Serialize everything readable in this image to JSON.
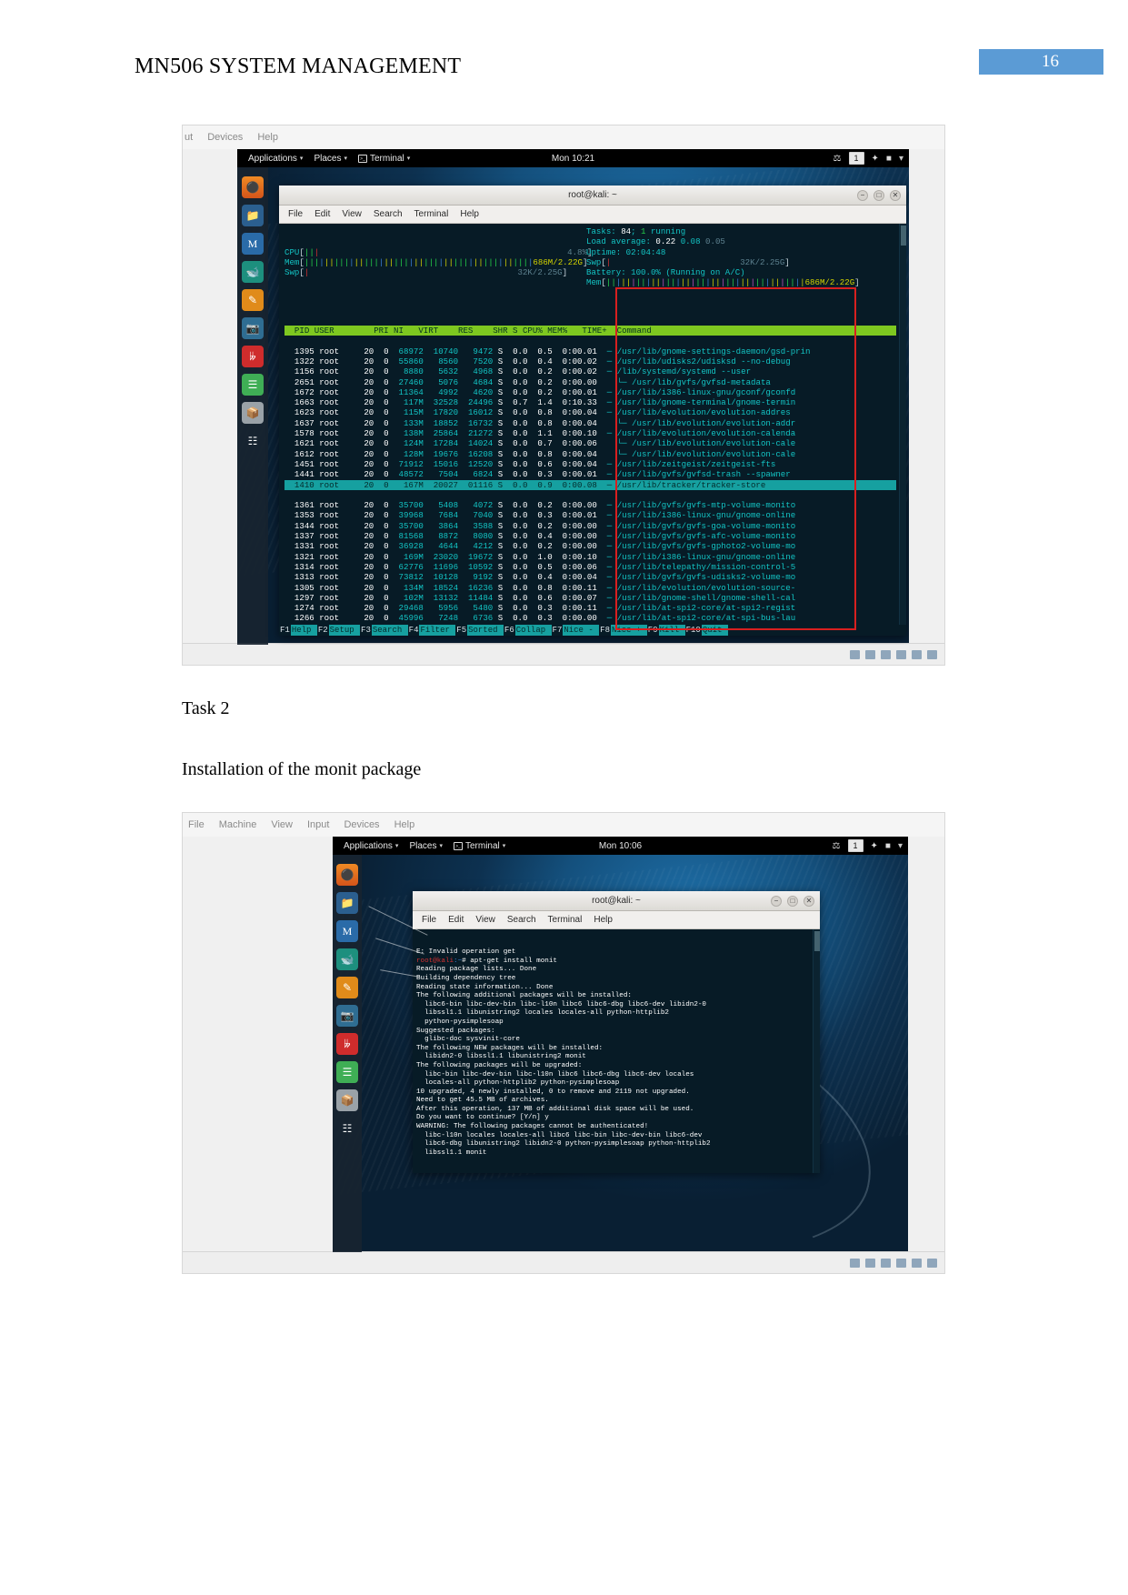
{
  "document": {
    "header_title": "MN506 SYSTEM MANAGEMENT",
    "page_number": "16",
    "accent_color": "#5b9bd5"
  },
  "body": {
    "task_heading": "Task 2",
    "section_text": "Installation of the monit package"
  },
  "figure1": {
    "vbox_menu": [
      "ut",
      "Devices",
      "Help"
    ],
    "panel": {
      "applications": "Applications",
      "places": "Places",
      "terminal": "Terminal",
      "clock": "Mon 10:21",
      "workspace": "1",
      "caret": "▾"
    },
    "window": {
      "title": "root@kali: ~",
      "menu": [
        "File",
        "Edit",
        "View",
        "Search",
        "Terminal",
        "Help"
      ],
      "minimize": "−",
      "maximize": "□",
      "close": "✕"
    },
    "htop": {
      "cpu_label": "CPU",
      "cpu_value": "4.8%",
      "mem_label": "Mem",
      "mem_value": "686M/2.22G",
      "swp_label": "Swp",
      "swp_value": "32K/2.25G",
      "tasks": "Tasks: 84; 1 running",
      "tasks_count": "84",
      "tasks_running": "1",
      "load_label": "Load average:",
      "load_1": "0.22",
      "load_5": "0.08",
      "load_15": "0.05",
      "uptime_label": "Uptime:",
      "uptime_value": "02:04:48",
      "swp2_label": "Swp",
      "swp2_value": "32K/2.25G",
      "battery": "Battery: 100.0% (Running on A/C)",
      "mem2_value": "686M/2.22G",
      "columns": [
        "PID",
        "USER",
        "PRI",
        "NI",
        "VIRT",
        "RES",
        "SHR",
        "S",
        "CPU%",
        "MEM%",
        "TIME+",
        "Command"
      ],
      "rows": [
        {
          "pid": "1395",
          "user": "root",
          "pri": "20",
          "ni": "0",
          "virt": "68972",
          "res": "10740",
          "shr": "9472",
          "s": "S",
          "cpu": "0.0",
          "mem": "0.5",
          "time": "0:00.01",
          "cmd": "─ /usr/lib/gnome-settings-daemon/gsd-prin",
          "sel": false
        },
        {
          "pid": "1322",
          "user": "root",
          "pri": "20",
          "ni": "0",
          "virt": "55860",
          "res": "8560",
          "shr": "7520",
          "s": "S",
          "cpu": "0.0",
          "mem": "0.4",
          "time": "0:00.02",
          "cmd": "─ /usr/lib/udisks2/udisksd --no-debug",
          "sel": false
        },
        {
          "pid": "1156",
          "user": "root",
          "pri": "20",
          "ni": "0",
          "virt": "8880",
          "res": "5632",
          "shr": "4968",
          "s": "S",
          "cpu": "0.0",
          "mem": "0.2",
          "time": "0:00.02",
          "cmd": "─ /lib/systemd/systemd --user",
          "sel": false
        },
        {
          "pid": "2651",
          "user": "root",
          "pri": "20",
          "ni": "0",
          "virt": "27460",
          "res": "5076",
          "shr": "4684",
          "s": "S",
          "cpu": "0.0",
          "mem": "0.2",
          "time": "0:00.00",
          "cmd": "  └─ /usr/lib/gvfs/gvfsd-metadata",
          "sel": false
        },
        {
          "pid": "1672",
          "user": "root",
          "pri": "20",
          "ni": "0",
          "virt": "11364",
          "res": "4992",
          "shr": "4620",
          "s": "S",
          "cpu": "0.0",
          "mem": "0.2",
          "time": "0:00.01",
          "cmd": "─ /usr/lib/i386-linux-gnu/gconf/gconfd",
          "sel": false
        },
        {
          "pid": "1663",
          "user": "root",
          "pri": "20",
          "ni": "0",
          "virt": "117M",
          "res": "32528",
          "shr": "24496",
          "s": "S",
          "cpu": "0.7",
          "mem": "1.4",
          "time": "0:10.33",
          "cmd": "─ /usr/lib/gnome-terminal/gnome-termin",
          "sel": false
        },
        {
          "pid": "1623",
          "user": "root",
          "pri": "20",
          "ni": "0",
          "virt": "115M",
          "res": "17820",
          "shr": "16012",
          "s": "S",
          "cpu": "0.0",
          "mem": "0.8",
          "time": "0:00.04",
          "cmd": "─ /usr/lib/evolution/evolution-addres",
          "sel": false
        },
        {
          "pid": "1637",
          "user": "root",
          "pri": "20",
          "ni": "0",
          "virt": "133M",
          "res": "18852",
          "shr": "16732",
          "s": "S",
          "cpu": "0.0",
          "mem": "0.8",
          "time": "0:00.04",
          "cmd": "  └─ /usr/lib/evolution/evolution-addr",
          "sel": false
        },
        {
          "pid": "1578",
          "user": "root",
          "pri": "20",
          "ni": "0",
          "virt": "138M",
          "res": "25864",
          "shr": "21272",
          "s": "S",
          "cpu": "0.0",
          "mem": "1.1",
          "time": "0:00.10",
          "cmd": "─ /usr/lib/evolution/evolution-calenda",
          "sel": false
        },
        {
          "pid": "1621",
          "user": "root",
          "pri": "20",
          "ni": "0",
          "virt": "124M",
          "res": "17284",
          "shr": "14024",
          "s": "S",
          "cpu": "0.0",
          "mem": "0.7",
          "time": "0:00.06",
          "cmd": "  └─ /usr/lib/evolution/evolution-cale",
          "sel": false
        },
        {
          "pid": "1612",
          "user": "root",
          "pri": "20",
          "ni": "0",
          "virt": "128M",
          "res": "19676",
          "shr": "16208",
          "s": "S",
          "cpu": "0.0",
          "mem": "0.8",
          "time": "0:00.04",
          "cmd": "  └─ /usr/lib/evolution/evolution-cale",
          "sel": false
        },
        {
          "pid": "1451",
          "user": "root",
          "pri": "20",
          "ni": "0",
          "virt": "71912",
          "res": "15016",
          "shr": "12520",
          "s": "S",
          "cpu": "0.0",
          "mem": "0.6",
          "time": "0:00.04",
          "cmd": "─ /usr/lib/zeitgeist/zeitgeist-fts",
          "sel": false
        },
        {
          "pid": "1441",
          "user": "root",
          "pri": "20",
          "ni": "0",
          "virt": "48572",
          "res": "7504",
          "shr": "6824",
          "s": "S",
          "cpu": "0.0",
          "mem": "0.3",
          "time": "0:00.01",
          "cmd": "─ /usr/lib/gvfs/gvfsd-trash --spawner",
          "sel": false
        },
        {
          "pid": "1410",
          "user": "root",
          "pri": "20",
          "ni": "0",
          "virt": "167M",
          "res": "20027",
          "shr": "01116",
          "s": "S",
          "cpu": "0.0",
          "mem": "0.9",
          "time": "0:00.08",
          "cmd": "─ /usr/lib/tracker/tracker-store",
          "sel": true
        },
        {
          "pid": "1361",
          "user": "root",
          "pri": "20",
          "ni": "0",
          "virt": "35700",
          "res": "5408",
          "shr": "4072",
          "s": "S",
          "cpu": "0.0",
          "mem": "0.2",
          "time": "0:00.00",
          "cmd": "─ /usr/lib/gvfs/gvfs-mtp-volume-monito",
          "sel": false
        },
        {
          "pid": "1353",
          "user": "root",
          "pri": "20",
          "ni": "0",
          "virt": "39968",
          "res": "7684",
          "shr": "7040",
          "s": "S",
          "cpu": "0.0",
          "mem": "0.3",
          "time": "0:00.01",
          "cmd": "─ /usr/lib/i386-linux-gnu/gnome-online",
          "sel": false
        },
        {
          "pid": "1344",
          "user": "root",
          "pri": "20",
          "ni": "0",
          "virt": "35700",
          "res": "3864",
          "shr": "3588",
          "s": "S",
          "cpu": "0.0",
          "mem": "0.2",
          "time": "0:00.00",
          "cmd": "─ /usr/lib/gvfs/gvfs-goa-volume-monito",
          "sel": false
        },
        {
          "pid": "1337",
          "user": "root",
          "pri": "20",
          "ni": "0",
          "virt": "81568",
          "res": "8872",
          "shr": "8080",
          "s": "S",
          "cpu": "0.0",
          "mem": "0.4",
          "time": "0:00.00",
          "cmd": "─ /usr/lib/gvfs/gvfs-afc-volume-monito",
          "sel": false
        },
        {
          "pid": "1331",
          "user": "root",
          "pri": "20",
          "ni": "0",
          "virt": "36928",
          "res": "4644",
          "shr": "4212",
          "s": "S",
          "cpu": "0.0",
          "mem": "0.2",
          "time": "0:00.00",
          "cmd": "─ /usr/lib/gvfs/gvfs-gphoto2-volume-mo",
          "sel": false
        },
        {
          "pid": "1321",
          "user": "root",
          "pri": "20",
          "ni": "0",
          "virt": "169M",
          "res": "23020",
          "shr": "19672",
          "s": "S",
          "cpu": "0.0",
          "mem": "1.0",
          "time": "0:00.10",
          "cmd": "─ /usr/lib/i386-linux-gnu/gnome-online",
          "sel": false
        },
        {
          "pid": "1314",
          "user": "root",
          "pri": "20",
          "ni": "0",
          "virt": "62776",
          "res": "11696",
          "shr": "10592",
          "s": "S",
          "cpu": "0.0",
          "mem": "0.5",
          "time": "0:00.06",
          "cmd": "─ /usr/lib/telepathy/mission-control-5",
          "sel": false
        },
        {
          "pid": "1313",
          "user": "root",
          "pri": "20",
          "ni": "0",
          "virt": "73812",
          "res": "10128",
          "shr": "9192",
          "s": "S",
          "cpu": "0.0",
          "mem": "0.4",
          "time": "0:00.04",
          "cmd": "─ /usr/lib/gvfs/gvfs-udisks2-volume-mo",
          "sel": false
        },
        {
          "pid": "1305",
          "user": "root",
          "pri": "20",
          "ni": "0",
          "virt": "134M",
          "res": "18524",
          "shr": "16236",
          "s": "S",
          "cpu": "0.0",
          "mem": "0.8",
          "time": "0:00.11",
          "cmd": "─ /usr/lib/evolution/evolution-source-",
          "sel": false
        },
        {
          "pid": "1297",
          "user": "root",
          "pri": "20",
          "ni": "0",
          "virt": "102M",
          "res": "13132",
          "shr": "11484",
          "s": "S",
          "cpu": "0.0",
          "mem": "0.6",
          "time": "0:00.07",
          "cmd": "─ /usr/lib/gnome-shell/gnome-shell-cal",
          "sel": false
        },
        {
          "pid": "1274",
          "user": "root",
          "pri": "20",
          "ni": "0",
          "virt": "29468",
          "res": "5956",
          "shr": "5480",
          "s": "S",
          "cpu": "0.0",
          "mem": "0.3",
          "time": "0:00.11",
          "cmd": "─ /usr/lib/at-spi2-core/at-spi2-regist",
          "sel": false
        },
        {
          "pid": "1266",
          "user": "root",
          "pri": "20",
          "ni": "0",
          "virt": "45996",
          "res": "7248",
          "shr": "6736",
          "s": "S",
          "cpu": "0.0",
          "mem": "0.3",
          "time": "0:00.00",
          "cmd": "─ /usr/lib/at-spi2-core/at-spi-bus-lau",
          "sel": false
        }
      ],
      "fkeys": [
        {
          "n": "F1",
          "l": "Help"
        },
        {
          "n": "F2",
          "l": "Setup"
        },
        {
          "n": "F3",
          "l": "Search"
        },
        {
          "n": "F4",
          "l": "Filter"
        },
        {
          "n": "F5",
          "l": "Sorted"
        },
        {
          "n": "F6",
          "l": "Collap"
        },
        {
          "n": "F7",
          "l": "Nice -"
        },
        {
          "n": "F8",
          "l": "Nice +"
        },
        {
          "n": "F9",
          "l": "Kill"
        },
        {
          "n": "F10",
          "l": "Quit"
        }
      ]
    }
  },
  "figure2": {
    "vbox_menu": [
      "File",
      "Machine",
      "View",
      "Input",
      "Devices",
      "Help"
    ],
    "panel": {
      "applications": "Applications",
      "places": "Places",
      "terminal": "Terminal",
      "clock": "Mon 10:06",
      "workspace": "1",
      "caret": "▾"
    },
    "window": {
      "title": "root@kali: ~",
      "menu": [
        "File",
        "Edit",
        "View",
        "Search",
        "Terminal",
        "Help"
      ]
    },
    "terminal_lines": [
      "E: Invalid operation get",
      "root@kali:~# apt-get install monit",
      "Reading package lists... Done",
      "Building dependency tree",
      "Reading state information... Done",
      "The following additional packages will be installed:",
      "  libc6-bin libc-dev-bin libc-l10n libc6 libc6-dbg libc6-dev libidn2-0",
      "  libssl1.1 libunistring2 locales locales-all python-httplib2",
      "  python-pysimplesoap",
      "Suggested packages:",
      "  glibc-doc sysvinit-core",
      "The following NEW packages will be installed:",
      "  libidn2-0 libssl1.1 libunistring2 monit",
      "The following packages will be upgraded:",
      "  libc-bin libc-dev-bin libc-l10n libc6 libc6-dbg libc6-dev locales",
      "  locales-all python-httplib2 python-pysimplesoap",
      "10 upgraded, 4 newly installed, 0 to remove and 2119 not upgraded.",
      "Need to get 45.5 MB of archives.",
      "After this operation, 137 MB of additional disk space will be used.",
      "Do you want to continue? [Y/n] y",
      "WARNING: The following packages cannot be authenticated!",
      "  libc-l10n locales locales-all libc6 libc-bin libc-dev-bin libc6-dev",
      "  libc6-dbg libunistring2 libidn2-0 python-pysimplesoap python-httplib2",
      "  libssl1.1 monit"
    ]
  }
}
